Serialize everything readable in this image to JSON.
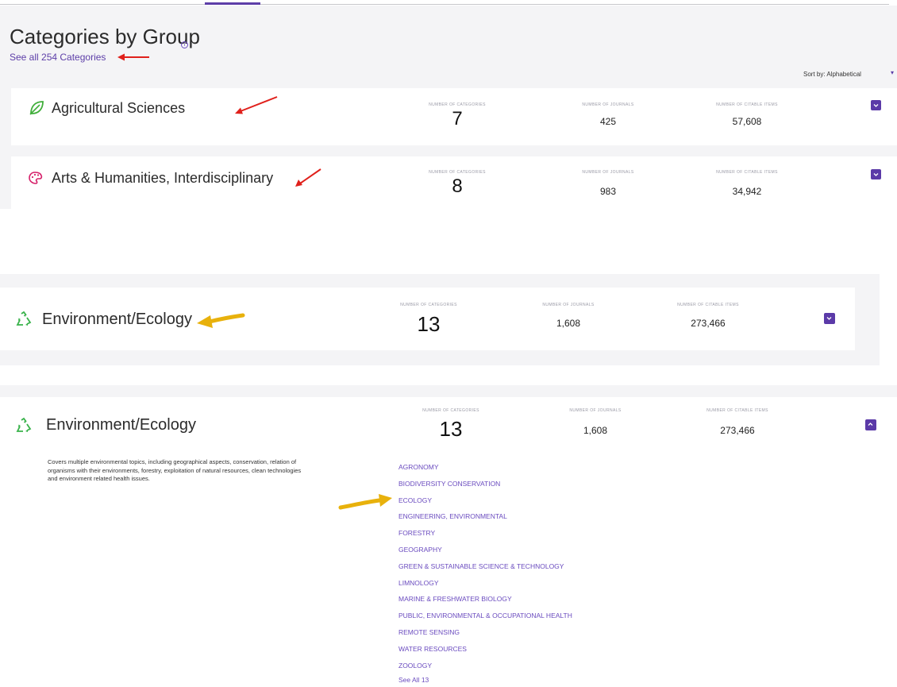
{
  "header": {
    "title": "Categories by Group",
    "info_icon": "info-icon",
    "see_all_link": "See all 254 Categories",
    "sort_label": "Sort by: Alphabetical"
  },
  "stat_labels": {
    "categories": "NUMBER OF CATEGORIES",
    "journals": "NUMBER OF JOURNALS",
    "citable_items": "NUMBER OF CITABLE ITEMS"
  },
  "groups": [
    {
      "name": "Agricultural Sciences",
      "icon": "leaf-icon",
      "categories": "7",
      "journals": "425",
      "citable_items": "57,608"
    },
    {
      "name": "Arts & Humanities, Interdisciplinary",
      "icon": "palette-icon",
      "categories": "8",
      "journals": "983",
      "citable_items": "34,942"
    },
    {
      "name": "Environment/Ecology",
      "icon": "recycle-icon",
      "categories": "13",
      "journals": "1,608",
      "citable_items": "273,466"
    }
  ],
  "expanded": {
    "name": "Environment/Ecology",
    "icon": "recycle-icon",
    "categories": "13",
    "journals": "1,608",
    "citable_items": "273,466",
    "description": "Covers multiple environmental topics, including geographical aspects, conservation, relation of organisms with their environments, forestry, exploitation of natural resources, clean technologies and environment related health issues.",
    "category_list": [
      "AGRONOMY",
      "BIODIVERSITY CONSERVATION",
      "ECOLOGY",
      "ENGINEERING, ENVIRONMENTAL",
      "FORESTRY",
      "GEOGRAPHY",
      "GREEN & SUSTAINABLE SCIENCE & TECHNOLOGY",
      "LIMNOLOGY",
      "MARINE & FRESHWATER BIOLOGY",
      "PUBLIC, ENVIRONMENTAL & OCCUPATIONAL HEALTH",
      "REMOTE SENSING",
      "WATER RESOURCES",
      "ZOOLOGY"
    ],
    "see_all": "See All 13"
  },
  "colors": {
    "accent_purple": "#5b3aa8",
    "link_purple": "#6a4bbf",
    "annotation_red": "#e0201b",
    "annotation_yellow": "#e8b10c",
    "leaf_green": "#3fae3a",
    "palette_pink": "#d6206a",
    "recycle_green": "#38b24a"
  }
}
